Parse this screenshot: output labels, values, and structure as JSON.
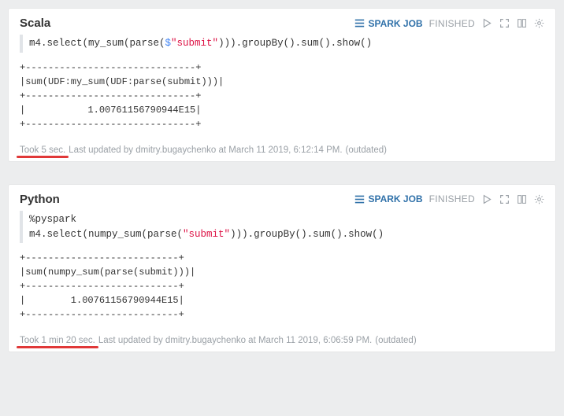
{
  "cells": [
    {
      "title": "Scala",
      "sparkJobLabel": "SPARK JOB",
      "status": "FINISHED",
      "code_prefix": "m4.select(my_sum(parse(",
      "code_dollar": "$",
      "code_string": "\"submit\"",
      "code_suffix": "))).groupBy().sum().show()",
      "output": "+------------------------------+\n|sum(UDF:my_sum(UDF:parse(submit)))|\n+------------------------------+\n|           1.00761156790944E15|\n+------------------------------+",
      "took": "Took 5 sec.",
      "updated": "Last updated by dmitry.bugaychenko at March 11 2019, 6:12:14 PM.",
      "outdated": "(outdated)"
    },
    {
      "title": "Python",
      "sparkJobLabel": "SPARK JOB",
      "status": "FINISHED",
      "code_line1": "%pyspark",
      "code_prefix": "m4.select(numpy_sum(parse(",
      "code_dollar": "",
      "code_string": "\"submit\"",
      "code_suffix": "))).groupBy().sum().show()",
      "output": "+---------------------------+\n|sum(numpy_sum(parse(submit)))|\n+---------------------------+\n|        1.00761156790944E15|\n+---------------------------+",
      "took": "Took 1 min 20 sec.",
      "updated": "Last updated by dmitry.bugaychenko at March 11 2019, 6:06:59 PM.",
      "outdated": "(outdated)"
    }
  ],
  "icons": {
    "sparkBars": "bars-icon",
    "run": "run-icon",
    "expand": "expand-icon",
    "book": "book-icon",
    "gear": "gear-icon"
  }
}
